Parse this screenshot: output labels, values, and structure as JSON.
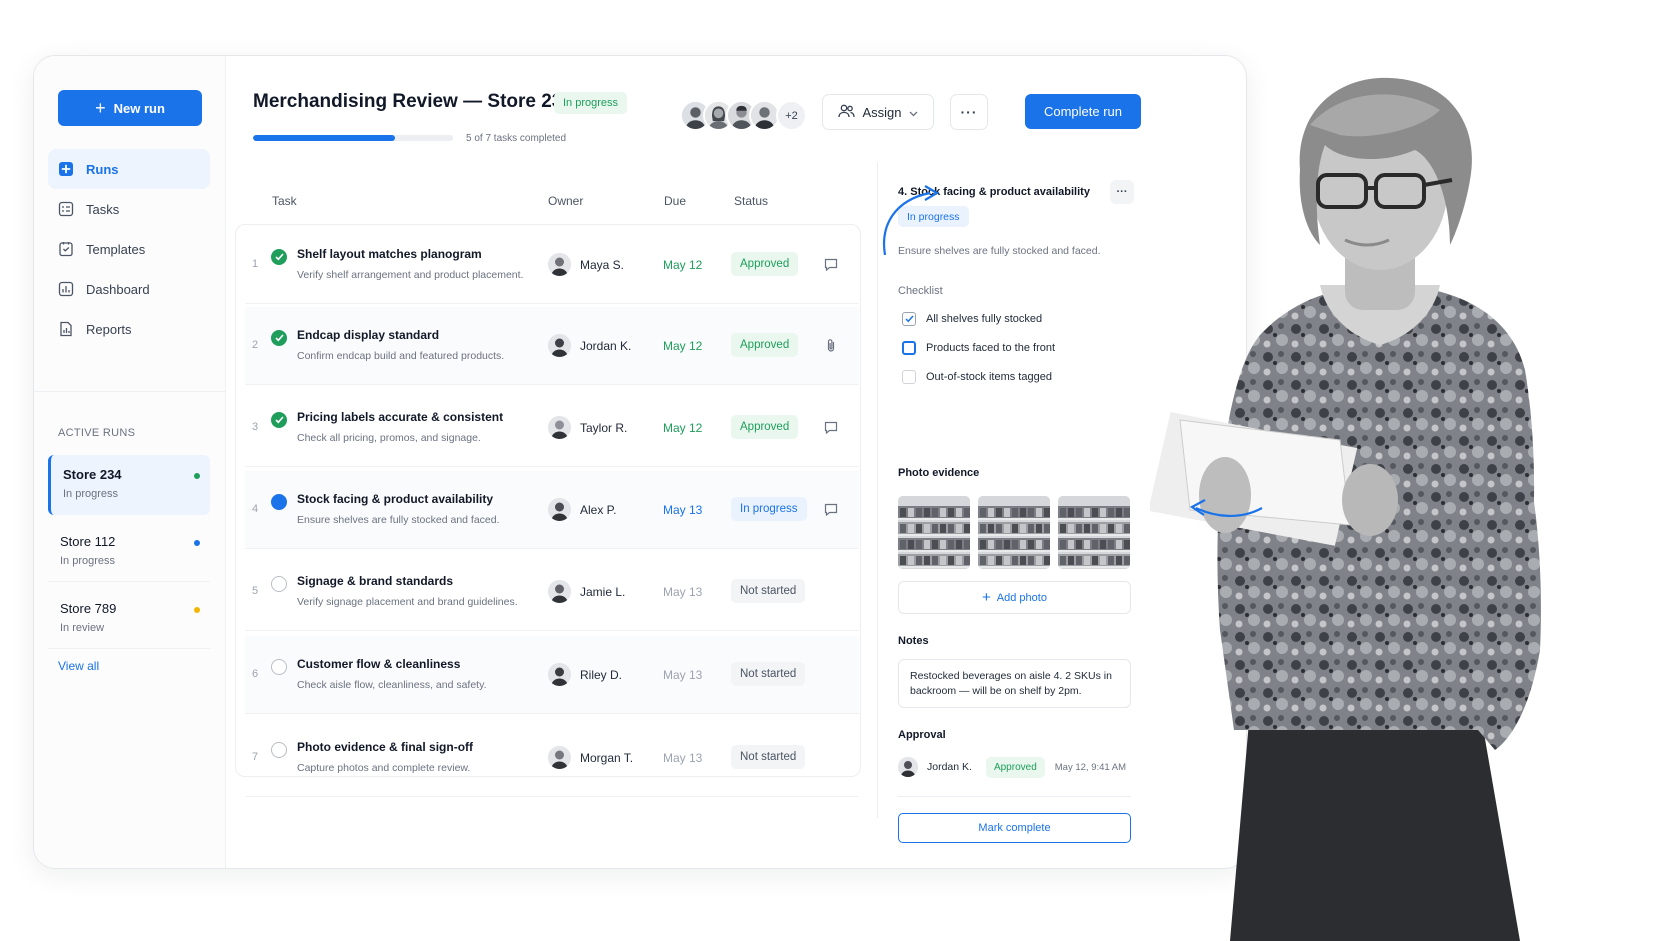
{
  "sidebar": {
    "new_run_label": "New run",
    "nav": [
      {
        "label": "Runs",
        "icon": "runs-icon",
        "active": true
      },
      {
        "label": "Tasks",
        "icon": "tasks-icon",
        "active": false
      },
      {
        "label": "Templates",
        "icon": "templates-icon",
        "active": false
      },
      {
        "label": "Dashboard",
        "icon": "dashboard-icon",
        "active": false
      },
      {
        "label": "Reports",
        "icon": "reports-icon",
        "active": false
      }
    ],
    "section_label": "ACTIVE RUNS",
    "runs": [
      {
        "name": "Store 234",
        "status": "In progress",
        "dot_color": "#1e9e5a"
      },
      {
        "name": "Store 112",
        "status": "In progress",
        "dot_color": "#1a73e8"
      },
      {
        "name": "Store 789",
        "status": "In review",
        "dot_color": "#f2b705"
      }
    ],
    "view_all": "View all"
  },
  "header": {
    "title": "Merchandising Review — Store 234",
    "status_badge": "In progress",
    "progress_text": "5 of 7 tasks completed",
    "progress_fraction": 0.71,
    "avatars_extra": "+2",
    "assign_label": "Assign",
    "more_label": "···",
    "complete_label": "Complete run"
  },
  "table": {
    "columns": {
      "task": "Task",
      "owner": "Owner",
      "due": "Due",
      "status": "Status"
    },
    "rows": [
      {
        "num": "1",
        "title": "Shelf layout matches planogram",
        "desc": "Verify shelf arrangement and product placement.",
        "owner": "Maya S.",
        "due": "May 12",
        "status": "Approved",
        "state": "done",
        "action_icon": "comment-icon"
      },
      {
        "num": "2",
        "title": "Endcap display standard",
        "desc": "Confirm endcap build and featured products.",
        "owner": "Jordan K.",
        "due": "May 12",
        "status": "Approved",
        "state": "done",
        "action_icon": "attachment-icon"
      },
      {
        "num": "3",
        "title": "Pricing labels accurate & consistent",
        "desc": "Check all pricing, promos, and signage.",
        "owner": "Taylor R.",
        "due": "May 12",
        "status": "Approved",
        "state": "done",
        "action_icon": "comment-icon"
      },
      {
        "num": "4",
        "title": "Stock facing & product availability",
        "desc": "Ensure shelves are fully stocked and faced.",
        "owner": "Alex P.",
        "due": "May 13",
        "status": "In progress",
        "state": "active",
        "action_icon": "comment-icon"
      },
      {
        "num": "5",
        "title": "Signage & brand standards",
        "desc": "Verify signage placement and brand guidelines.",
        "owner": "Jamie L.",
        "due": "May 13",
        "status": "Not started",
        "state": "todo",
        "action_icon": ""
      },
      {
        "num": "6",
        "title": "Customer flow & cleanliness",
        "desc": "Check aisle flow, cleanliness, and safety.",
        "owner": "Riley D.",
        "due": "May 13",
        "status": "Not started",
        "state": "todo",
        "action_icon": ""
      },
      {
        "num": "7",
        "title": "Photo evidence & final sign-off",
        "desc": "Capture photos and complete review.",
        "owner": "Morgan T.",
        "due": "May 13",
        "status": "Not started",
        "state": "todo",
        "action_icon": ""
      }
    ]
  },
  "detail": {
    "title": "4. Stock facing & product availability",
    "more_label": "···",
    "status_badge": "In progress",
    "description": "Ensure shelves are fully stocked and faced.",
    "checklist_label": "Checklist",
    "checklist": [
      {
        "label": "All shelves fully stocked",
        "state": "checked"
      },
      {
        "label": "Products faced to the front",
        "state": "focused"
      },
      {
        "label": "Out-of-stock items tagged",
        "state": "empty"
      }
    ],
    "photo_label": "Photo evidence",
    "photo_count": 3,
    "add_photo_label": "Add photo",
    "notes_label": "Notes",
    "notes_text": "Restocked beverages on aisle 4. 2 SKUs in backroom — will be on shelf by 2pm.",
    "approval_label": "Approval",
    "approver": "Jordan K.",
    "approval_status": "Approved",
    "approval_time": "May 12, 9:41 AM",
    "mark_complete_label": "Mark complete"
  },
  "colors": {
    "accent": "#1a73e8",
    "approved_bg": "#e9f7ef",
    "approved_text": "#1e9e5a",
    "progress_bg": "#eaf2fd",
    "neutral_bg": "#f3f4f6"
  }
}
